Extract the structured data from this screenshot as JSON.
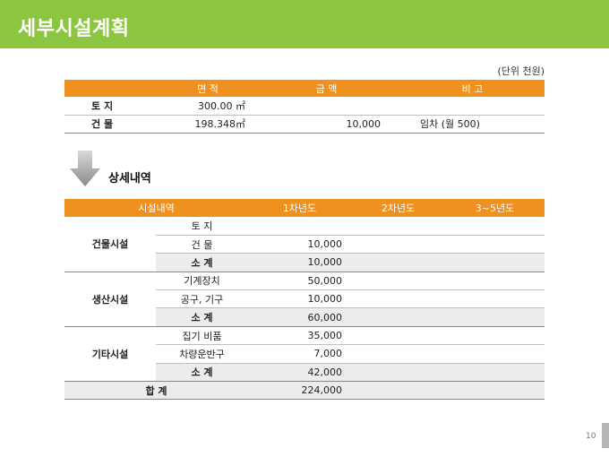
{
  "page": {
    "title": "세부시설계획",
    "unit_note": "(단위 천원)",
    "section_title": "상세내역",
    "page_number": "10"
  },
  "summary_table": {
    "headers": [
      "",
      "면    적",
      "금    액",
      "비    고"
    ],
    "rows": [
      {
        "label": "토  지",
        "area": "300.00 ㎡",
        "amount": "",
        "note": ""
      },
      {
        "label": "건  물",
        "area": "198.348㎡",
        "amount": "10,000",
        "note": "임차 (월 500)"
      }
    ]
  },
  "detail_table": {
    "headers": [
      "시설내역",
      "1차년도",
      "2차년도",
      "3~5년도"
    ],
    "groups": [
      {
        "name": "건물시설",
        "items": [
          {
            "name": "토  지",
            "y1": ""
          },
          {
            "name": "건  물",
            "y1": "10,000"
          }
        ],
        "subtotal": {
          "name": "소      계",
          "y1": "10,000"
        }
      },
      {
        "name": "생산시설",
        "items": [
          {
            "name": "기계장치",
            "y1": "50,000"
          },
          {
            "name": "공구, 기구",
            "y1": "10,000"
          }
        ],
        "subtotal": {
          "name": "소      계",
          "y1": "60,000"
        }
      },
      {
        "name": "기타시설",
        "items": [
          {
            "name": "집기 비품",
            "y1": "35,000"
          },
          {
            "name": "차량운반구",
            "y1": "7,000"
          }
        ],
        "subtotal": {
          "name": "소      계",
          "y1": "42,000"
        }
      }
    ],
    "total": {
      "name": "합      계",
      "y1": "224,000"
    }
  },
  "colors": {
    "header_bar": "#8cc641",
    "table_header": "#f0901e",
    "subtotal_fill": "#ececec"
  }
}
